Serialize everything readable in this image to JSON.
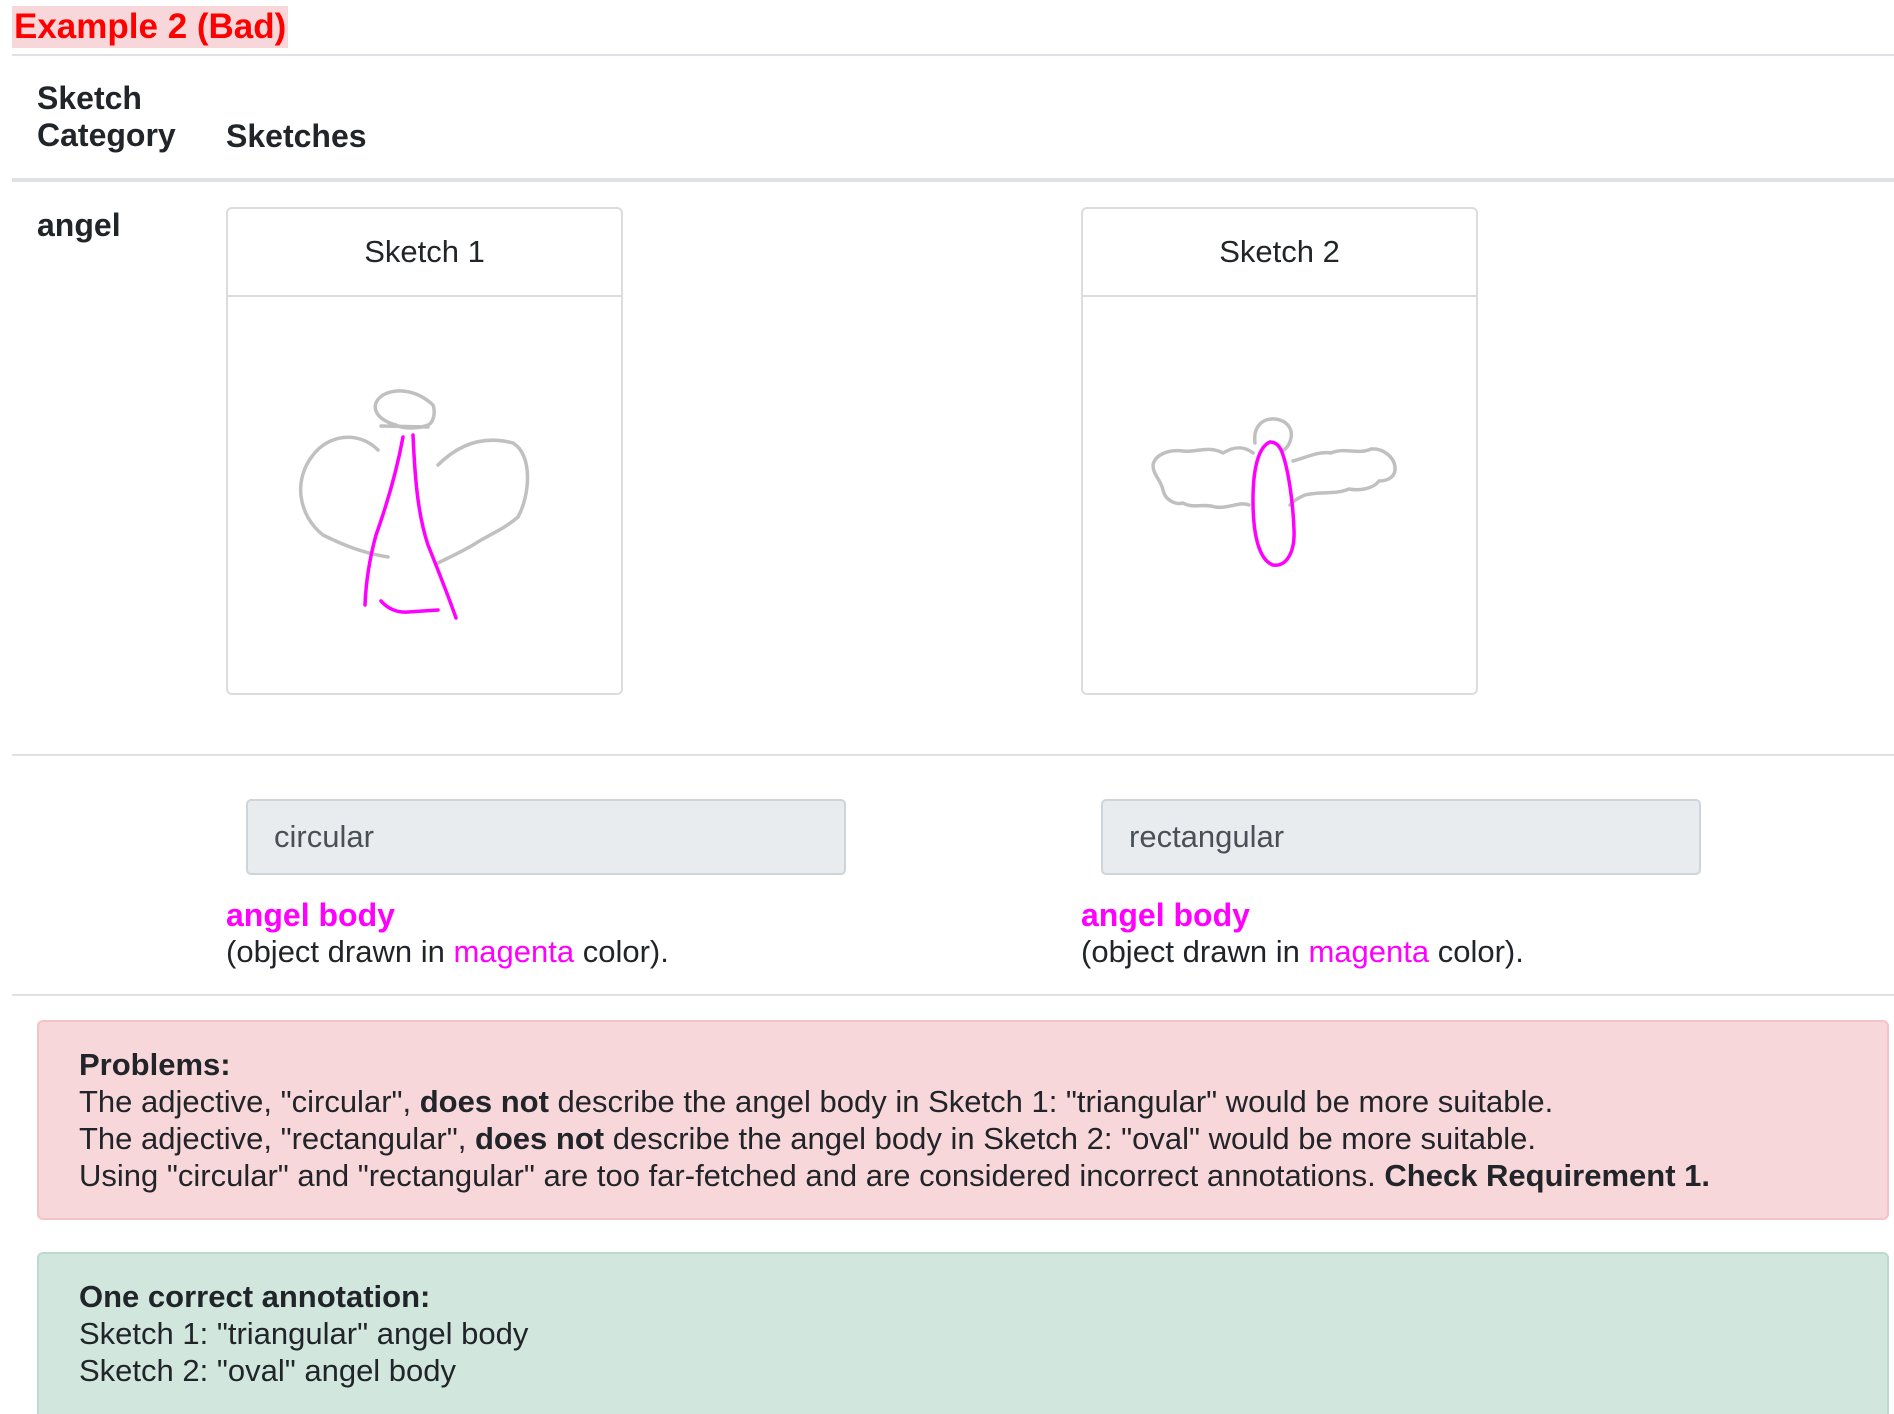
{
  "title": "Example 2 (Bad)",
  "table": {
    "header_category_line1": "Sketch",
    "header_category_line2": "Category",
    "header_sketches": "Sketches",
    "category": "angel"
  },
  "sketches": [
    {
      "label": "Sketch 1",
      "adjective": "circular",
      "part_name": "angel body",
      "desc_prefix": "(object drawn in ",
      "desc_color": "magenta",
      "desc_suffix": " color)."
    },
    {
      "label": "Sketch 2",
      "adjective": "rectangular",
      "part_name": "angel body",
      "desc_prefix": "(object drawn in ",
      "desc_color": "magenta",
      "desc_suffix": " color)."
    }
  ],
  "problems": {
    "heading": "Problems:",
    "line1_a": "The adjective, \"circular\", ",
    "line1_b": "does not",
    "line1_c": " describe the angel body in Sketch 1: \"triangular\" would be more suitable.",
    "line2_a": "The adjective, \"rectangular\", ",
    "line2_b": "does not",
    "line2_c": " describe the angel body in Sketch 2: \"oval\" would be more suitable.",
    "line3_a": "Using \"circular\" and \"rectangular\" are too far-fetched and are considered incorrect annotations. ",
    "line3_b": "Check Requirement 1."
  },
  "correct": {
    "heading": "One correct annotation:",
    "line1": "Sketch 1: \"triangular\" angel body",
    "line2": "Sketch 2: \"oval\" angel body"
  },
  "colors": {
    "highlight": "#ff00ff",
    "stroke_gray": "#c0c0c0",
    "title_red": "#ff0000",
    "danger_bg": "#f8d7da",
    "success_bg": "#d1e7dd"
  }
}
